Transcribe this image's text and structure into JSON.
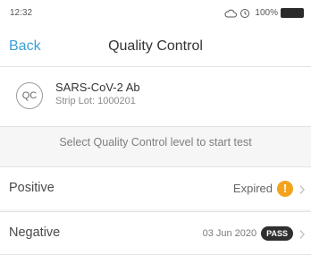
{
  "status_bar": {
    "time": "12:32",
    "battery_text": "100%",
    "icons": [
      "cloud-icon",
      "sync-icon",
      "battery-icon"
    ]
  },
  "nav": {
    "back_label": "Back",
    "title": "Quality Control"
  },
  "strip": {
    "badge": "QC",
    "name": "SARS-CoV-2 Ab",
    "lot": "Strip Lot: 1000201"
  },
  "instruction": "Select Quality Control level to start test",
  "rows": [
    {
      "label": "Positive",
      "status": "Expired",
      "icon": "warning-icon"
    },
    {
      "label": "Negative",
      "date": "03 Jun 2020",
      "badge": "PASS"
    }
  ],
  "colors": {
    "accent": "#3aa0d8",
    "warning": "#f2a31e",
    "pass_badge": "#2f2f2f"
  }
}
